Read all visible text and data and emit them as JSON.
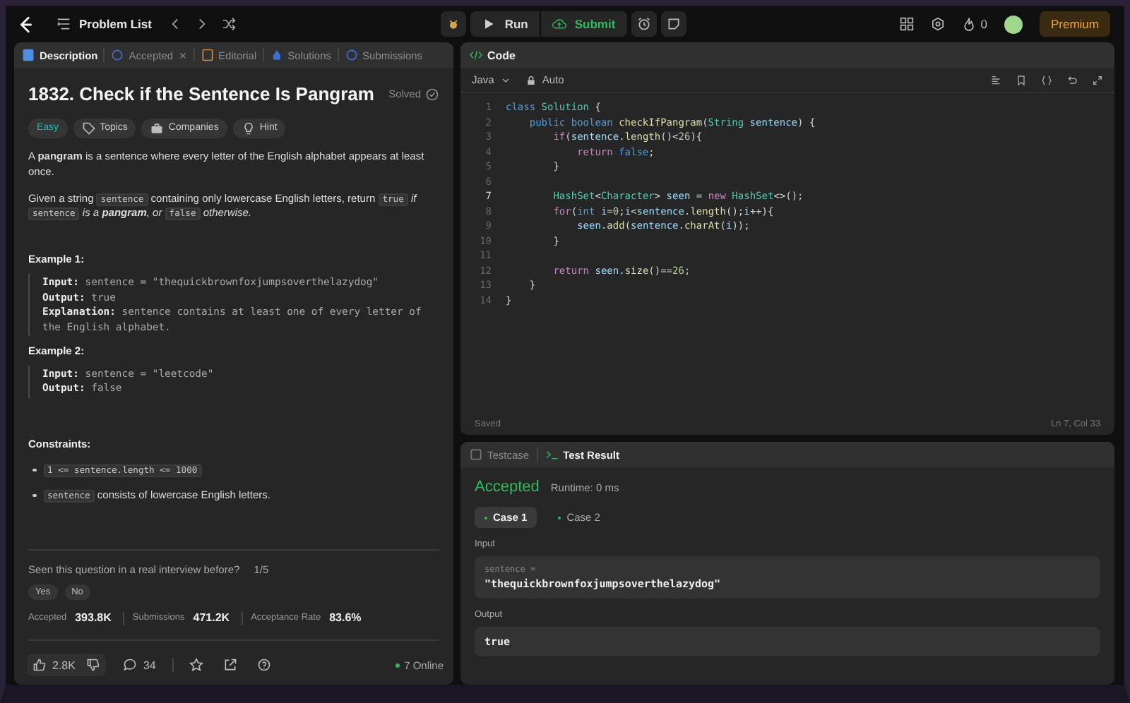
{
  "topbar": {
    "problem_list": "Problem List",
    "run": "Run",
    "submit": "Submit",
    "streak": "0",
    "premium": "Premium"
  },
  "description_tabs": [
    {
      "label": "Description",
      "kind": "description",
      "selected": true,
      "closable": false
    },
    {
      "label": "Accepted",
      "kind": "accepted",
      "selected": false,
      "closable": true
    },
    {
      "label": "Editorial",
      "kind": "editorial",
      "selected": false,
      "closable": false
    },
    {
      "label": "Solutions",
      "kind": "solutions",
      "selected": false,
      "closable": false
    },
    {
      "label": "Submissions",
      "kind": "submissions",
      "selected": false,
      "closable": false
    }
  ],
  "problem": {
    "title": "1832. Check if the Sentence Is Pangram",
    "status": "Solved",
    "tags": [
      {
        "label": "Easy",
        "kind": "difficulty"
      },
      {
        "label": "Topics",
        "kind": "topics"
      },
      {
        "label": "Companies",
        "kind": "companies"
      },
      {
        "label": "Hint",
        "kind": "hint"
      }
    ],
    "paragraphs": [
      [
        {
          "kind": "text",
          "text": "A **pangram** is a sentence where every letter of the English alphabet appears at least once."
        }
      ],
      [
        {
          "kind": "text",
          "text": "Given a string "
        },
        {
          "kind": "code",
          "text": "sentence"
        },
        {
          "kind": "text",
          "text": " containing only lowercase English letters, return "
        },
        {
          "kind": "code",
          "text": "true"
        },
        {
          "kind": "em",
          "text": " if "
        },
        {
          "kind": "code",
          "text": "sentence"
        },
        {
          "kind": "em",
          "text": " is a **pangram**, or "
        },
        {
          "kind": "code",
          "text": "false"
        },
        {
          "kind": "em",
          "text": " otherwise."
        }
      ]
    ],
    "examples": [
      {
        "title": "Example 1:",
        "lines": [
          {
            "label": "Input:",
            "value": "sentence = \"thequickbrownfoxjumpsoverthelazydog\""
          },
          {
            "label": "Output:",
            "value": "true"
          },
          {
            "label": "Explanation:",
            "value": "sentence contains at least one of every letter of the English alphabet."
          }
        ]
      },
      {
        "title": "Example 2:",
        "lines": [
          {
            "label": "Input:",
            "value": "sentence = \"leetcode\""
          },
          {
            "label": "Output:",
            "value": "false"
          }
        ]
      }
    ],
    "constraints_title": "Constraints:",
    "constraints": [
      [
        {
          "kind": "code",
          "text": "1 <= sentence.length <= 1000"
        }
      ],
      [
        {
          "kind": "code",
          "text": "sentence"
        },
        {
          "kind": "text",
          "text": " consists of lowercase English letters."
        }
      ]
    ],
    "interview_question": "Seen this question in a real interview before?",
    "interview_count": "1/5",
    "answers": [
      "Yes",
      "No"
    ],
    "stats": [
      {
        "label": "Accepted",
        "value": "393.8K"
      },
      {
        "label": "Submissions",
        "value": "471.2K"
      },
      {
        "label": "Acceptance Rate",
        "value": "83.6%"
      }
    ],
    "likes": "2.8K",
    "comments": "34",
    "online": "7 Online"
  },
  "code": {
    "title": "Code",
    "language": "Java",
    "mode": "Auto",
    "saved": "Saved",
    "cursor": "Ln 7, Col 33",
    "lines": [
      {
        "n": "1",
        "current": false,
        "tokens": [
          {
            "kind": "kw",
            "text": "class"
          },
          {
            "kind": "type",
            "text": " Solution"
          },
          {
            "kind": "plain",
            "text": " {"
          }
        ]
      },
      {
        "n": "2",
        "current": false,
        "tokens": [
          {
            "kind": "kw",
            "text": "    public boolean"
          },
          {
            "kind": "fn",
            "text": " checkIfPangram"
          },
          {
            "kind": "plain",
            "text": "("
          },
          {
            "kind": "type",
            "text": "String"
          },
          {
            "kind": "var",
            "text": " sentence"
          },
          {
            "kind": "plain",
            "text": ") {"
          }
        ]
      },
      {
        "n": "3",
        "current": false,
        "tokens": [
          {
            "kind": "ctrl",
            "text": "        if"
          },
          {
            "kind": "plain",
            "text": "("
          },
          {
            "kind": "var",
            "text": "sentence"
          },
          {
            "kind": "plain",
            "text": "."
          },
          {
            "kind": "fn",
            "text": "length"
          },
          {
            "kind": "plain",
            "text": "()<"
          },
          {
            "kind": "num",
            "text": "26"
          },
          {
            "kind": "plain",
            "text": "){"
          }
        ]
      },
      {
        "n": "4",
        "current": false,
        "tokens": [
          {
            "kind": "ctrl",
            "text": "            return"
          },
          {
            "kind": "kw",
            "text": " false"
          },
          {
            "kind": "plain",
            "text": ";"
          }
        ]
      },
      {
        "n": "5",
        "current": false,
        "tokens": [
          {
            "kind": "plain",
            "text": "        }"
          }
        ]
      },
      {
        "n": "6",
        "current": false
      },
      {
        "n": "7",
        "current": true,
        "tokens": [
          {
            "kind": "type",
            "text": "        HashSet"
          },
          {
            "kind": "plain",
            "text": "<"
          },
          {
            "kind": "type",
            "text": "Character"
          },
          {
            "kind": "plain",
            "text": ">"
          },
          {
            "kind": "var",
            "text": " seen"
          },
          {
            "kind": "plain",
            "text": " ="
          },
          {
            "kind": "ctrl",
            "text": " new"
          },
          {
            "kind": "type",
            "text": " HashSet"
          },
          {
            "kind": "plain",
            "text": "<>();"
          }
        ]
      },
      {
        "n": "8",
        "current": false,
        "tokens": [
          {
            "kind": "ctrl",
            "text": "        for"
          },
          {
            "kind": "plain",
            "text": "("
          },
          {
            "kind": "kw",
            "text": "int"
          },
          {
            "kind": "var",
            "text": " i"
          },
          {
            "kind": "plain",
            "text": "="
          },
          {
            "kind": "num",
            "text": "0"
          },
          {
            "kind": "plain",
            "text": ";"
          },
          {
            "kind": "var",
            "text": "i"
          },
          {
            "kind": "plain",
            "text": "<"
          },
          {
            "kind": "var",
            "text": "sentence"
          },
          {
            "kind": "plain",
            "text": "."
          },
          {
            "kind": "fn",
            "text": "length"
          },
          {
            "kind": "plain",
            "text": "();"
          },
          {
            "kind": "var",
            "text": "i"
          },
          {
            "kind": "plain",
            "text": "++){"
          }
        ]
      },
      {
        "n": "9",
        "current": false,
        "tokens": [
          {
            "kind": "var",
            "text": "            seen"
          },
          {
            "kind": "plain",
            "text": "."
          },
          {
            "kind": "fn",
            "text": "add"
          },
          {
            "kind": "plain",
            "text": "("
          },
          {
            "kind": "var",
            "text": "sentence"
          },
          {
            "kind": "plain",
            "text": "."
          },
          {
            "kind": "fn",
            "text": "charAt"
          },
          {
            "kind": "plain",
            "text": "("
          },
          {
            "kind": "var",
            "text": "i"
          },
          {
            "kind": "plain",
            "text": "));"
          }
        ]
      },
      {
        "n": "10",
        "current": false,
        "tokens": [
          {
            "kind": "plain",
            "text": "        }"
          }
        ]
      },
      {
        "n": "11",
        "current": false
      },
      {
        "n": "12",
        "current": false,
        "tokens": [
          {
            "kind": "ctrl",
            "text": "        return"
          },
          {
            "kind": "var",
            "text": " seen"
          },
          {
            "kind": "plain",
            "text": "."
          },
          {
            "kind": "fn",
            "text": "size"
          },
          {
            "kind": "plain",
            "text": "()=="
          },
          {
            "kind": "num",
            "text": "26"
          },
          {
            "kind": "plain",
            "text": ";"
          }
        ]
      },
      {
        "n": "13",
        "current": false,
        "tokens": [
          {
            "kind": "plain",
            "text": "    }"
          }
        ]
      },
      {
        "n": "14",
        "current": false,
        "tokens": [
          {
            "kind": "plain",
            "text": "}"
          }
        ]
      }
    ]
  },
  "result_tabs": [
    {
      "label": "Testcase",
      "kind": "testcase",
      "selected": false
    },
    {
      "label": "Test Result",
      "kind": "result",
      "selected": true
    }
  ],
  "result": {
    "verdict": "Accepted",
    "runtime": "Runtime: 0 ms",
    "cases": [
      {
        "label": "Case 1",
        "selected": true
      },
      {
        "label": "Case 2",
        "selected": false
      }
    ],
    "input_label": "Input",
    "param_name": "sentence =",
    "param_value": "\"thequickbrownfoxjumpsoverthelazydog\"",
    "output_label": "Output",
    "output_value": "true"
  }
}
